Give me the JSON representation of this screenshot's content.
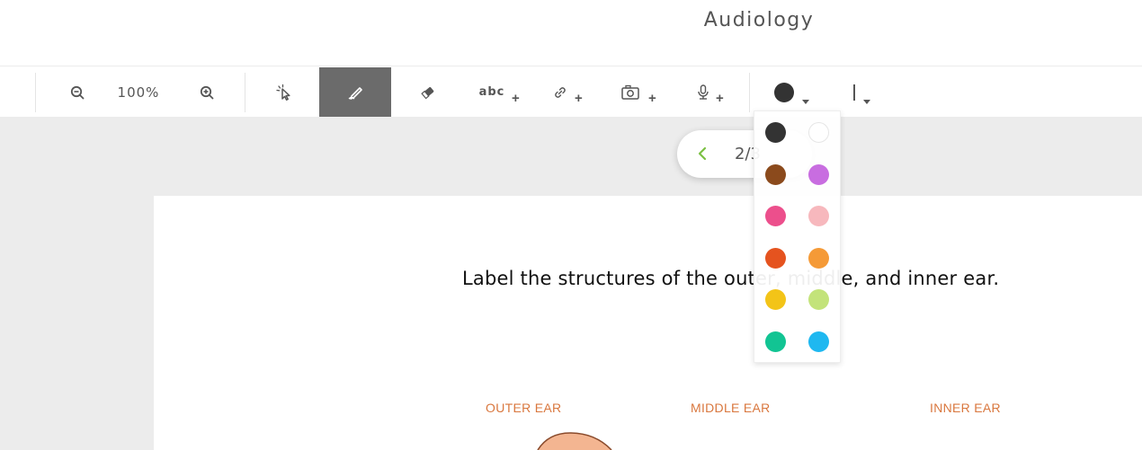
{
  "header": {
    "title": "Audiology"
  },
  "toolbar": {
    "zoom_level": "100%",
    "text_tool_label": "abc",
    "plus_symbol": "+",
    "selected_color": "#333333"
  },
  "pager": {
    "text": "2/3"
  },
  "document": {
    "question": "Label the structures of the outer, middle, and inner ear.",
    "labels": {
      "outer": "OUTER EAR",
      "middle": "MIDDLE EAR",
      "inner": "INNER EAR"
    }
  },
  "palette": {
    "colors": [
      "#333333",
      "#ffffff",
      "#8b4a1c",
      "#c86de0",
      "#ec4f8c",
      "#f7b8bd",
      "#e5531f",
      "#f59a37",
      "#f3c418",
      "#c3e37a",
      "#12c493",
      "#1fb8f0"
    ]
  }
}
